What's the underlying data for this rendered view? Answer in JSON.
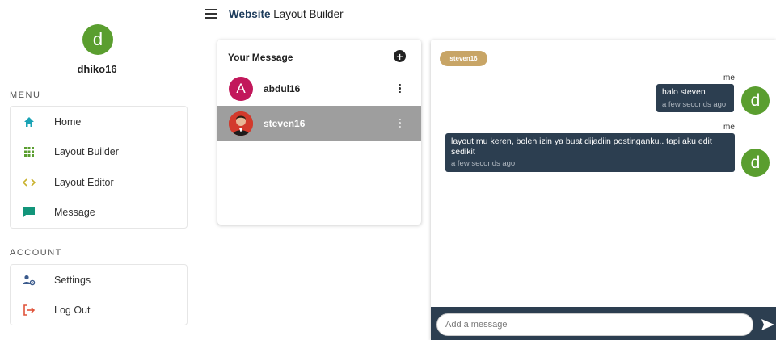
{
  "header": {
    "title_strong": "Website",
    "title_rest": " Layout Builder"
  },
  "profile": {
    "initial": "d",
    "username": "dhiko16"
  },
  "menu": {
    "section_label": "MENU",
    "items": [
      {
        "label": "Home",
        "icon": "home-icon",
        "color": "#1aa3b5"
      },
      {
        "label": "Layout Builder",
        "icon": "grid-icon",
        "color": "#5a9e2f"
      },
      {
        "label": "Layout Editor",
        "icon": "code-icon",
        "color": "#c9b22e"
      },
      {
        "label": "Message",
        "icon": "chat-icon",
        "color": "#12957a"
      }
    ]
  },
  "account": {
    "section_label": "ACCOUNT",
    "items": [
      {
        "label": "Settings",
        "icon": "user-settings-icon",
        "color": "#3a5a8c"
      },
      {
        "label": "Log Out",
        "icon": "logout-icon",
        "color": "#e0533a"
      }
    ]
  },
  "messages": {
    "title": "Your Message",
    "add_icon": "plus-circle-icon",
    "conversations": [
      {
        "name": "abdul16",
        "initial": "A",
        "avatar_color": "#c2185b",
        "active": false
      },
      {
        "name": "steven16",
        "initial": "",
        "avatar_type": "photo",
        "active": true
      }
    ]
  },
  "chat": {
    "recipient_chip": "steven16",
    "messages": [
      {
        "sender": "me",
        "text": "halo steven",
        "time": "a few seconds ago",
        "avatar_initial": "d"
      },
      {
        "sender": "me",
        "text": "layout mu keren, boleh izin ya buat dijadiin postinganku.. tapi aku edit sedikit",
        "time": "a few seconds ago",
        "avatar_initial": "d"
      }
    ],
    "input_placeholder": "Add a message",
    "send_icon": "send-icon"
  },
  "colors": {
    "avatar_green": "#5a9e2f",
    "bubble_dark": "#2c3e50",
    "chip_gold": "#c8a566",
    "active_row": "#9e9e9e"
  }
}
